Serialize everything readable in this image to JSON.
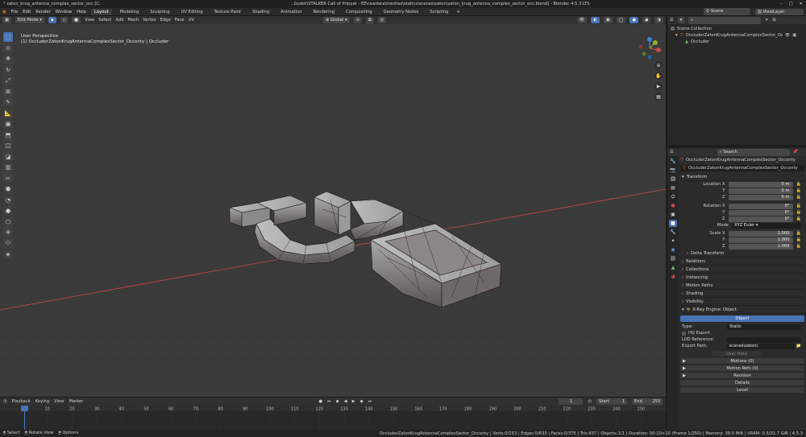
{
  "titlebar": {
    "left": "* zaton_krug_antenna_complex_sector_occ [C:",
    "center": "..Godot\\STALKER Call of Pripyat - EE\\rawdata\\meshes\\statics\\scenes\\zaton\\zaton_krug_antenna_complex_sector_occ.blend] - Blender 4.5.3 LTS"
  },
  "menu": {
    "items": [
      "File",
      "Edit",
      "Render",
      "Window",
      "Help"
    ],
    "workspaces": [
      "Layout",
      "Modeling",
      "Sculpting",
      "UV Editing",
      "Texture Paint",
      "Shading",
      "Animation",
      "Rendering",
      "Compositing",
      "Geometry Nodes",
      "Scripting"
    ],
    "active_workspace": "Layout",
    "scene": "Scene",
    "view_layer": "ViewLayer"
  },
  "viewport_header": {
    "mode": "Edit Mode",
    "menus": [
      "View",
      "Select",
      "Add",
      "Mesh",
      "Vertex",
      "Edge",
      "Face",
      "UV"
    ],
    "orientation": "Global",
    "options": "Options"
  },
  "viewport": {
    "perspective": "User Perspective",
    "object_label": "(1) OccluderZatonKrugAntennaComplexSector_Occonty | Occluder"
  },
  "tool_icons": [
    "select-box-icon",
    "cursor-icon",
    "move-icon",
    "rotate-icon",
    "scale-icon",
    "transform-icon",
    "annotate-icon",
    "measure-icon",
    "add-cube-icon",
    "extrude-icon",
    "inset-icon",
    "bevel-icon",
    "loop-cut-icon",
    "knife-icon",
    "poly-build-icon",
    "spin-icon",
    "smooth-icon",
    "edge-slide-icon",
    "shrink-icon",
    "shear-icon",
    "rip-icon"
  ],
  "outliner": {
    "root": "Scene Collection",
    "object": "OccluderZatonKrugAntennaComplexSector_Occonty",
    "child": "Occluder"
  },
  "props": {
    "search_placeholder": "Search",
    "object_path": "OccluderZatonKrugAntennaComplexSector_Occonty",
    "object_name": "OccluderZatonKrugAntennaComplexSector_Occonty",
    "transform": "Transform",
    "location_label": "Location X",
    "rotation_label": "Rotation X",
    "scale_label": "Scale X",
    "y": "Y",
    "z": "Z",
    "loc": [
      "0 m",
      "0 m",
      "0 m"
    ],
    "rot": [
      "0°",
      "0°",
      "0°"
    ],
    "mode_label": "Mode",
    "mode_value": "XYZ Euler",
    "scale": [
      "1.000",
      "1.000",
      "1.000"
    ],
    "delta": "Delta Transform",
    "panels": [
      "Relations",
      "Collections",
      "Instancing",
      "Motion Paths",
      "Shading",
      "Visibility"
    ],
    "xray_panel": "X-Ray Engine: Object",
    "object_btn": "Object",
    "type_label": "Type:",
    "type_value": "Static",
    "hq_export": "HQ Export",
    "lod_label": "LOD Reference:",
    "export_label": "Export Path:",
    "export_value": "scenes\\zaton\\",
    "user_data": "User Data",
    "motions": "Motions (0)",
    "motion_refs": "Motion Refs (0)",
    "revision": "Revision",
    "details": "Details",
    "level": "Level"
  },
  "timeline": {
    "menus": [
      "Playback",
      "Keying",
      "View",
      "Marker"
    ],
    "current_frame": "1",
    "start_label": "Start",
    "start": "1",
    "end_label": "End",
    "end": "250",
    "ticks": [
      "1",
      "10",
      "20",
      "30",
      "40",
      "50",
      "60",
      "70",
      "80",
      "90",
      "100",
      "110",
      "120",
      "130",
      "140",
      "150",
      "160",
      "170",
      "180",
      "190",
      "200",
      "210",
      "220",
      "230",
      "240",
      "250"
    ]
  },
  "status": {
    "select": "Select",
    "rotate": "Rotate View",
    "options": "Options",
    "info": "OccluderZatonKrugAntennaComplexSector_Occonty | Verts:0/253 | Edges:0/633 | Faces:0/375 | Tris:437 | Objects:1/1 | Duration: 00:10+10 (Frame 1/250) | Memory: 39.5 MiB | VRAM: 0.5/31.7 GiB | 4.5.3"
  },
  "colors": {
    "accent": "#4772b3",
    "viewport_bg": "#3a3a3a",
    "x_axis": "#c9474d",
    "y_axis": "#8bb42c",
    "z_axis": "#3d7fd9"
  }
}
